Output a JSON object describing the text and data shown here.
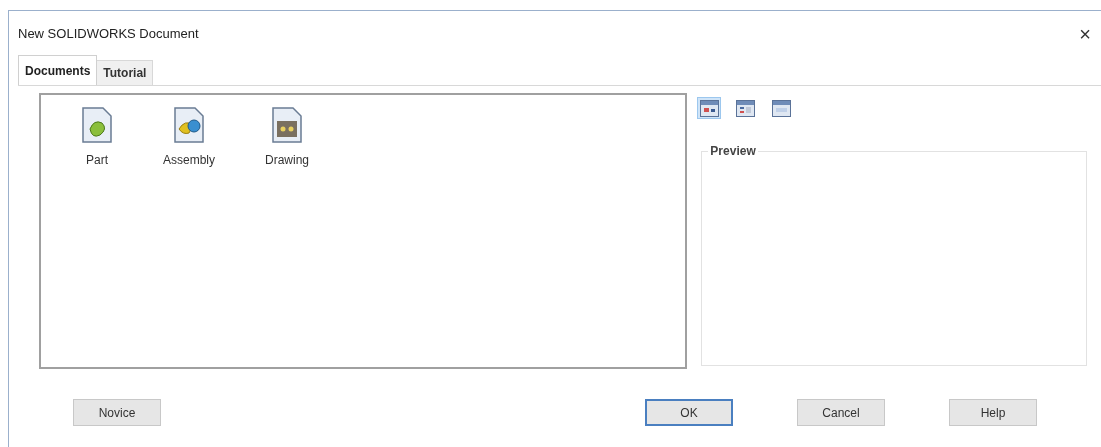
{
  "window": {
    "title": "New SOLIDWORKS Document",
    "close": "×"
  },
  "tabs": [
    {
      "label": "Documents",
      "selected": true
    },
    {
      "label": "Tutorial",
      "selected": false
    }
  ],
  "documents": [
    {
      "label": "Part",
      "kind": "part"
    },
    {
      "label": "Assembly",
      "kind": "assembly"
    },
    {
      "label": "Drawing",
      "kind": "drawing"
    }
  ],
  "view_buttons": [
    {
      "kind": "large",
      "selected": true
    },
    {
      "kind": "list",
      "selected": false
    },
    {
      "kind": "details",
      "selected": false
    }
  ],
  "preview": {
    "title": "Preview"
  },
  "buttons": [
    {
      "label": "Novice",
      "default": false
    },
    {
      "label": "OK",
      "default": true
    },
    {
      "label": "Cancel",
      "default": false
    },
    {
      "label": "Help",
      "default": false
    }
  ]
}
